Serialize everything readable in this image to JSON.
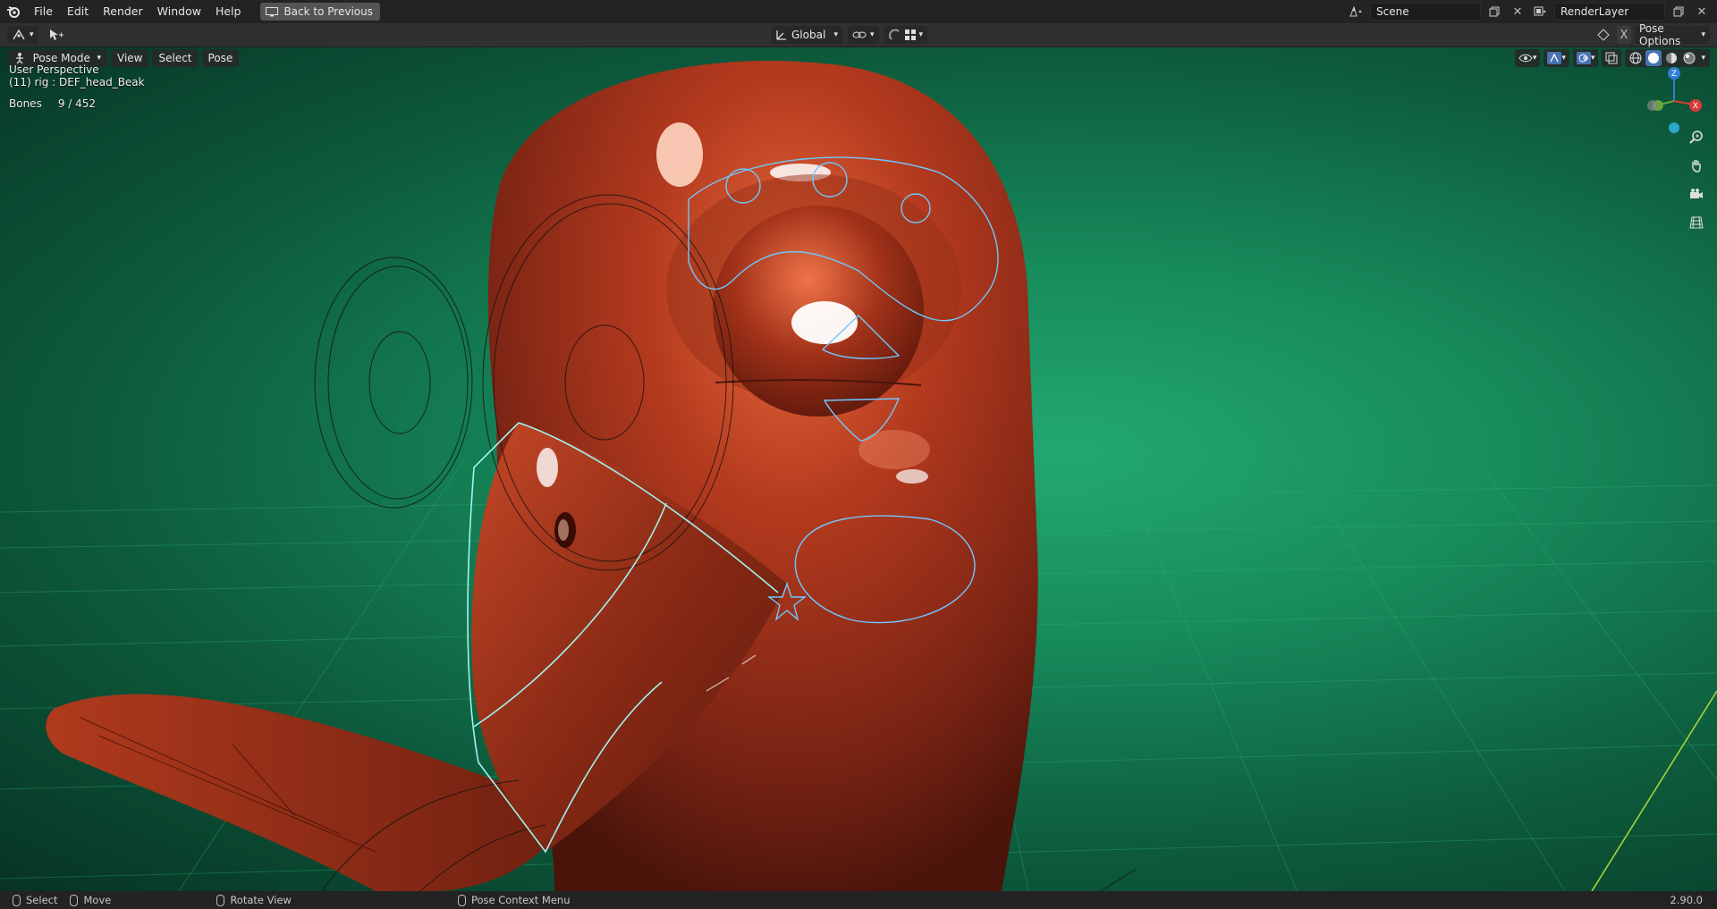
{
  "menubar": {
    "items": [
      "File",
      "Edit",
      "Render",
      "Window",
      "Help"
    ],
    "back_button": "Back to Previous",
    "scene": "Scene",
    "render_layer": "RenderLayer"
  },
  "toolbar": {
    "orientation": "Global",
    "close": "X",
    "pose_options": "Pose Options"
  },
  "viewport": {
    "mode": "Pose Mode",
    "menus": [
      "View",
      "Select",
      "Pose"
    ],
    "perspective": "User Perspective",
    "active_object": "(11) rig : DEF_head_Beak",
    "bones_label": "Bones",
    "bones_count": "9 / 452"
  },
  "statusbar": {
    "select": "Select",
    "move": "Move",
    "rotate": "Rotate View",
    "context_menu": "Pose Context Menu",
    "version": "2.90.0"
  },
  "colors": {
    "accent": "#4772b3",
    "background_green": "#178b5c",
    "model_red": "#a8321a",
    "bone_selected": "#6fc8ff",
    "bone_active": "#9ff3f0"
  }
}
